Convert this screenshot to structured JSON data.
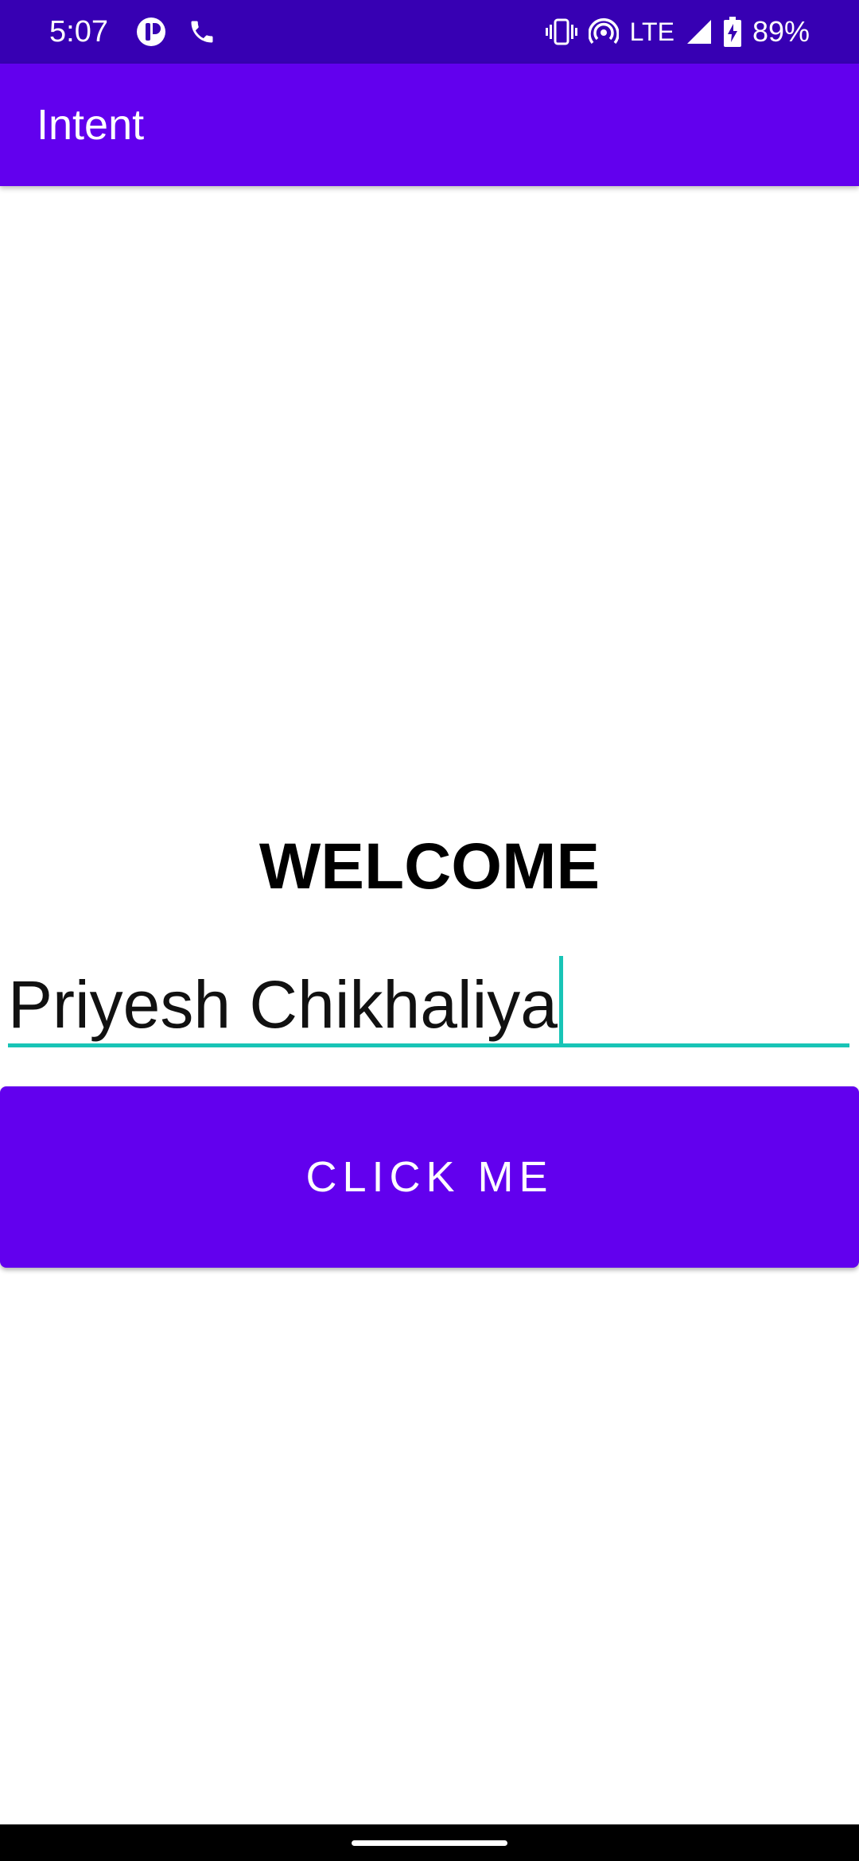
{
  "status_bar": {
    "time": "5:07",
    "network": "LTE",
    "battery": "89%",
    "background_color": "#3700b3",
    "left_icons": [
      "notification-app-icon",
      "phone-icon"
    ],
    "right_icons": [
      "vibrate-icon",
      "hotspot-icon",
      "signal-icon",
      "battery-charging-icon"
    ]
  },
  "app_bar": {
    "title": "Intent",
    "background_color": "#6200ee"
  },
  "main": {
    "heading": "WELCOME",
    "name_input": {
      "value": "Priyesh Chikhaliya",
      "focused": true,
      "accent_color": "#18c4b6"
    },
    "button": {
      "label": "CLICK ME",
      "background_color": "#6200ee"
    }
  },
  "nav_bar": {
    "type": "gesture-handle"
  }
}
